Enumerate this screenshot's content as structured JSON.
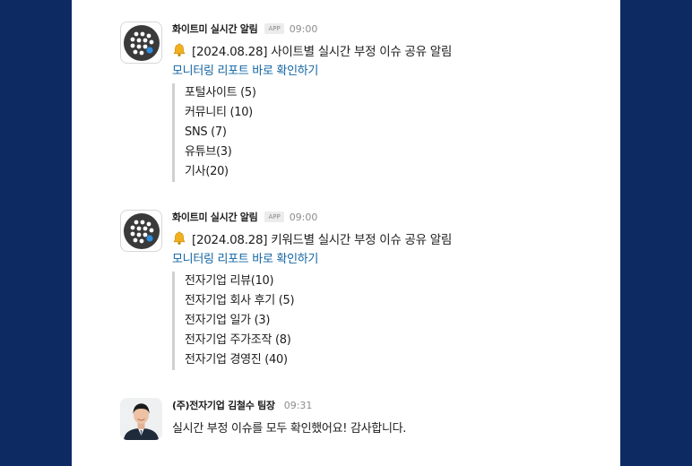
{
  "messages": [
    {
      "sender": "화이트미 실시간 알림",
      "badge": "APP",
      "time": "09:00",
      "bell_icon": "bell-icon",
      "headline": "[2024.08.28] 사이트별 실시간 부정 이슈 공유 알림",
      "link": "모니터링 리포트 바로 확인하기",
      "items": [
        "포털사이트 (5)",
        "커뮤니티 (10)",
        "SNS (7)",
        "유튜브(3)",
        "기사(20)"
      ]
    },
    {
      "sender": "화이트미 실시간 알림",
      "badge": "APP",
      "time": "09:00",
      "bell_icon": "bell-icon",
      "headline": "[2024.08.28] 키워드별 실시간 부정 이슈 공유 알림",
      "link": "모니터링 리포트 바로 확인하기",
      "items": [
        "전자기업 리뷰(10)",
        "전자기업 회사 후기 (5)",
        "전자기업 일가 (3)",
        "전자기업 주가조작 (8)",
        "전자기업 경영진 (40)"
      ]
    }
  ],
  "reply": {
    "sender": "(주)전자기업 김철수 팀장",
    "time": "09:31",
    "text": "실시간 부정 이슈를 모두 확인했어요! 감사합니다."
  },
  "colors": {
    "page_bg": "#0e2a63",
    "link": "#1264a3",
    "accent_dot": "#2d8ee0"
  }
}
